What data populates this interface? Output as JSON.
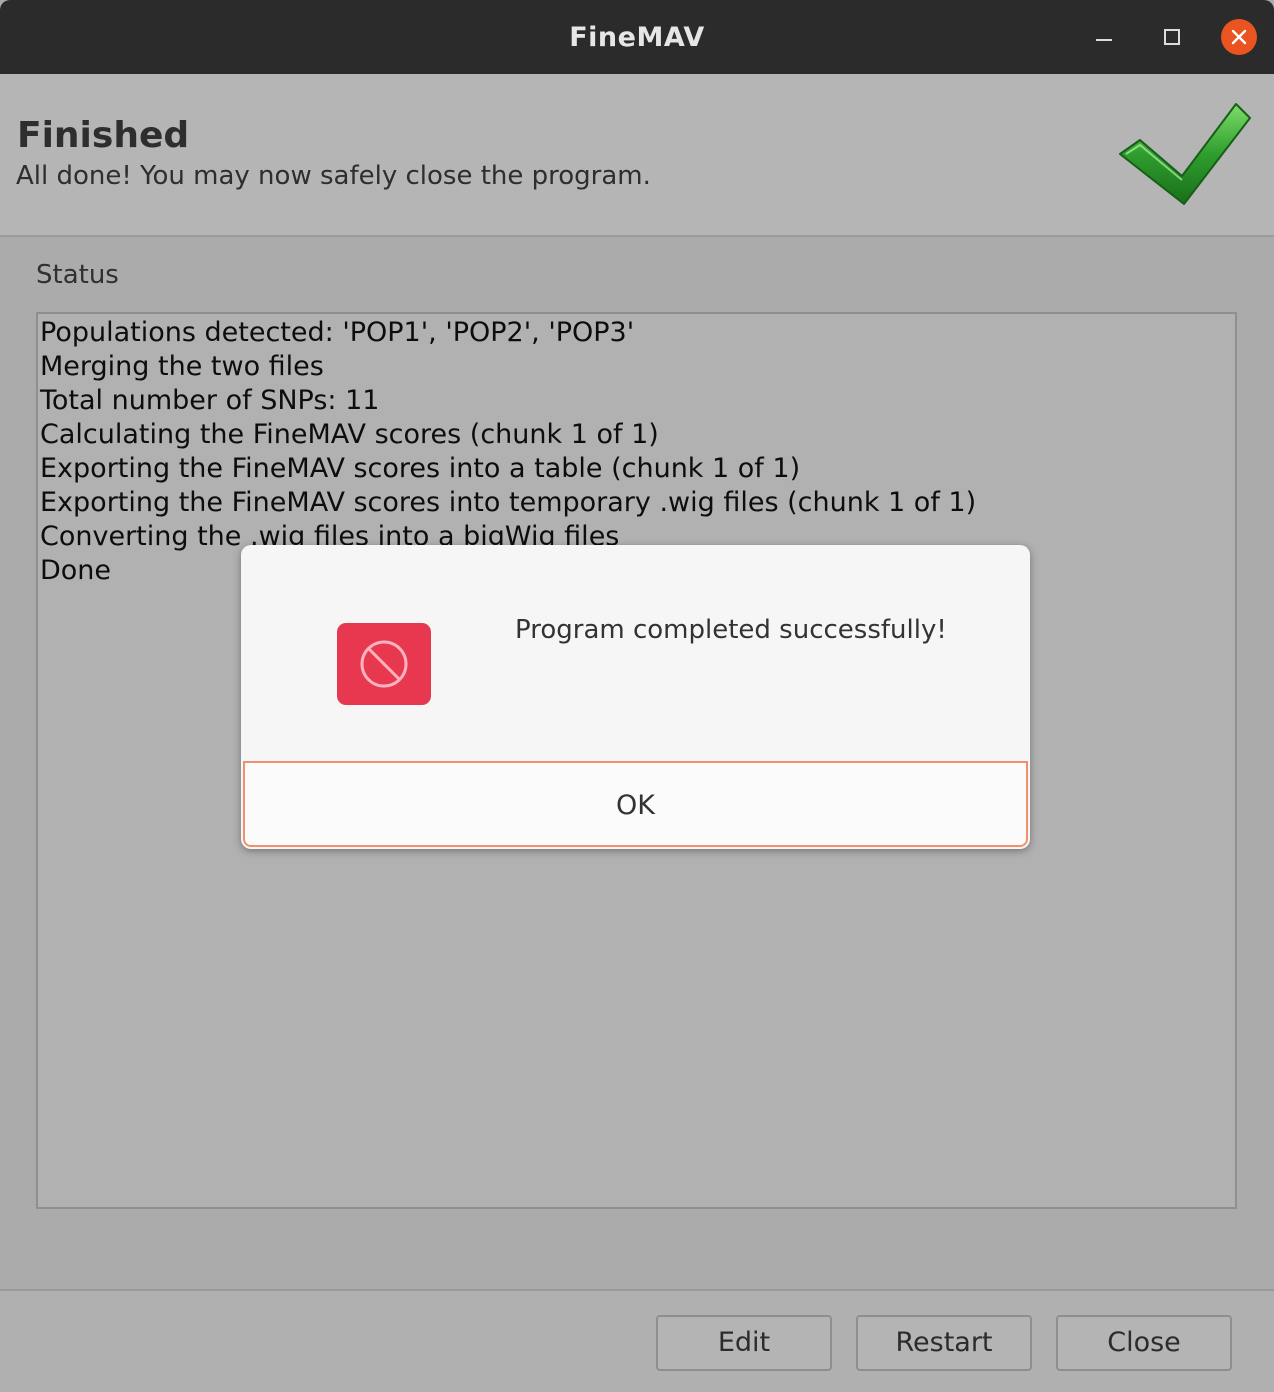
{
  "window": {
    "title": "FineMAV",
    "controls": {
      "minimize": "minimize-icon",
      "maximize": "maximize-icon",
      "close": "close-icon"
    }
  },
  "header": {
    "title": "Finished",
    "subtitle": "All done! You may now safely close the program.",
    "icon": "checkmark-icon"
  },
  "status": {
    "label": "Status",
    "lines": [
      "Populations detected: 'POP1', 'POP2', 'POP3'",
      "Merging the two files",
      "Total number of SNPs: 11",
      "Calculating the FineMAV scores (chunk 1 of 1)",
      "Exporting the FineMAV scores into a table (chunk 1 of 1)",
      "Exporting the FineMAV scores into temporary .wig files (chunk 1 of 1)",
      "Converting the .wig files into a bigWig files",
      "Done"
    ]
  },
  "footer": {
    "edit_label": "Edit",
    "restart_label": "Restart",
    "close_label": "Close"
  },
  "dialog": {
    "message": "Program completed successfully!",
    "ok_label": "OK",
    "icon": "prohibited-icon"
  },
  "colors": {
    "titlebar": "#2b2b2b",
    "close_button": "#e95420",
    "dialog_icon": "#e8384f",
    "ok_border": "#f0916c",
    "checkmark": "#2e9e2e"
  }
}
